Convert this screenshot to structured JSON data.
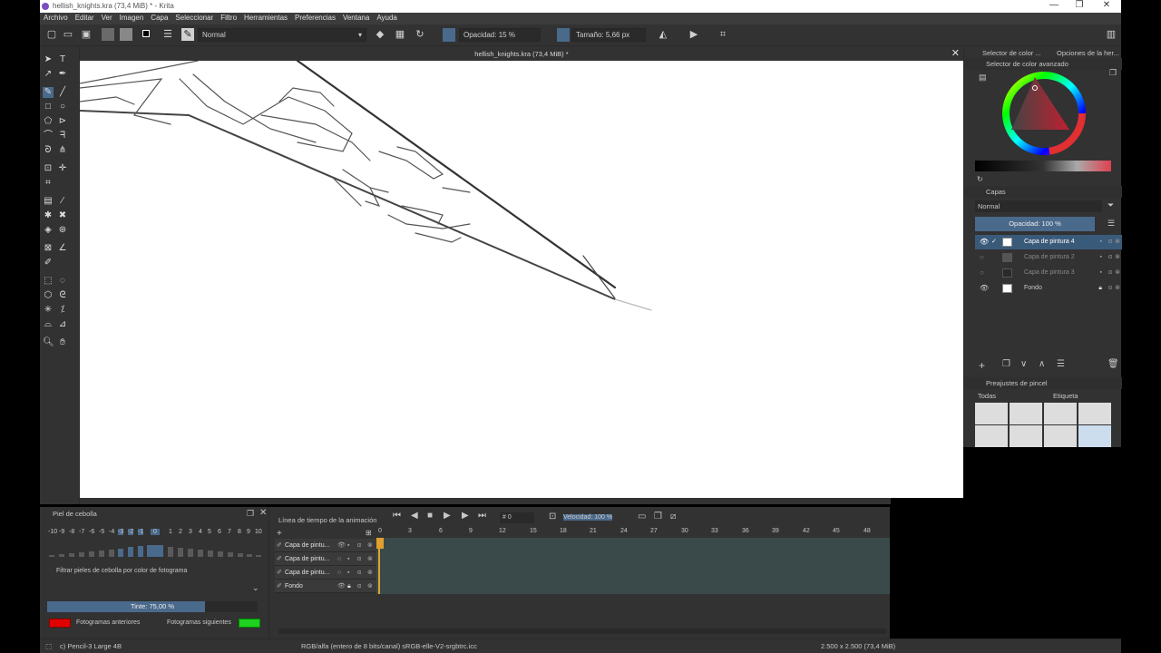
{
  "window": {
    "title": "hellish_knights.kra (73,4 MiB) * - Krita",
    "minimize": "—",
    "maximize": "❐",
    "close": "✕"
  },
  "menu": [
    "Archivo",
    "Editar",
    "Ver",
    "Imagen",
    "Capa",
    "Seleccionar",
    "Filtro",
    "Herramientas",
    "Preferencias",
    "Ventana",
    "Ayuda"
  ],
  "toolbar": {
    "blend_mode": "Normal",
    "opacity": "Opacidad: 15 %",
    "size": "Tamaño: 5,66 px"
  },
  "document": {
    "tab_title": "hellish_knights.kra (73,4 MiB) *",
    "close": "✕"
  },
  "right_dock": {
    "tab_color": "Selector de color ...",
    "tab_tool_options": "Opciones de la her...",
    "color_panel_title": "Selector de color avanzado",
    "layers_title": "Capas",
    "layers_blend": "Normal",
    "layers_opacity": "Opacidad: 100 %",
    "layers": [
      {
        "name": "Capa de pintura 4",
        "selected": true,
        "visible": true
      },
      {
        "name": "Capa de pintura 2",
        "selected": false,
        "visible": false
      },
      {
        "name": "Capa de pintura 3",
        "selected": false,
        "visible": false
      },
      {
        "name": "Fondo",
        "selected": false,
        "visible": true
      }
    ],
    "brush_title": "Preajustes de pincel",
    "brush_filter": "Todas",
    "brush_tag": "Etiqueta"
  },
  "onion": {
    "title": "Piel de cebolla",
    "numbers": [
      "-10",
      "-9",
      "-8",
      "-7",
      "-6",
      "-5",
      "-4",
      "-3",
      "-2",
      "-1",
      "0",
      "1",
      "2",
      "3",
      "4",
      "5",
      "6",
      "7",
      "8",
      "9",
      "10"
    ],
    "filter_label": "Filtrar pieles de cebolla por color de fotograma",
    "tint": "Tinte: 75,00 %",
    "tint_level": 0.75,
    "prev_label": "Fotogramas anteriores",
    "next_label": "Fotogramas siguientes",
    "prev_color": "#e00000",
    "next_color": "#20d020"
  },
  "timeline": {
    "title": "Línea de tiempo de la animación",
    "frame": "0",
    "speed": "Velocidad: 100 %",
    "frame_numbers": [
      "0",
      "3",
      "6",
      "9",
      "12",
      "15",
      "18",
      "21",
      "24",
      "27",
      "30",
      "33",
      "36",
      "39",
      "42",
      "45",
      "48"
    ],
    "layers": [
      "Capa de pintu...",
      "Capa de pintu...",
      "Capa de pintu...",
      "Fondo"
    ]
  },
  "status": {
    "brush": "c) Pencil-3 Large 4B",
    "colorspace": "RGB/alfa (entero de 8 bits/canal)  sRGB-elle-V2-srgbtrc.icc",
    "size": "2.500 x 2.500 (73,4 MiB)"
  },
  "colors": {
    "accent": "#4a6a8c",
    "panel": "#323232",
    "selected_layer": "#3a5a7a"
  }
}
